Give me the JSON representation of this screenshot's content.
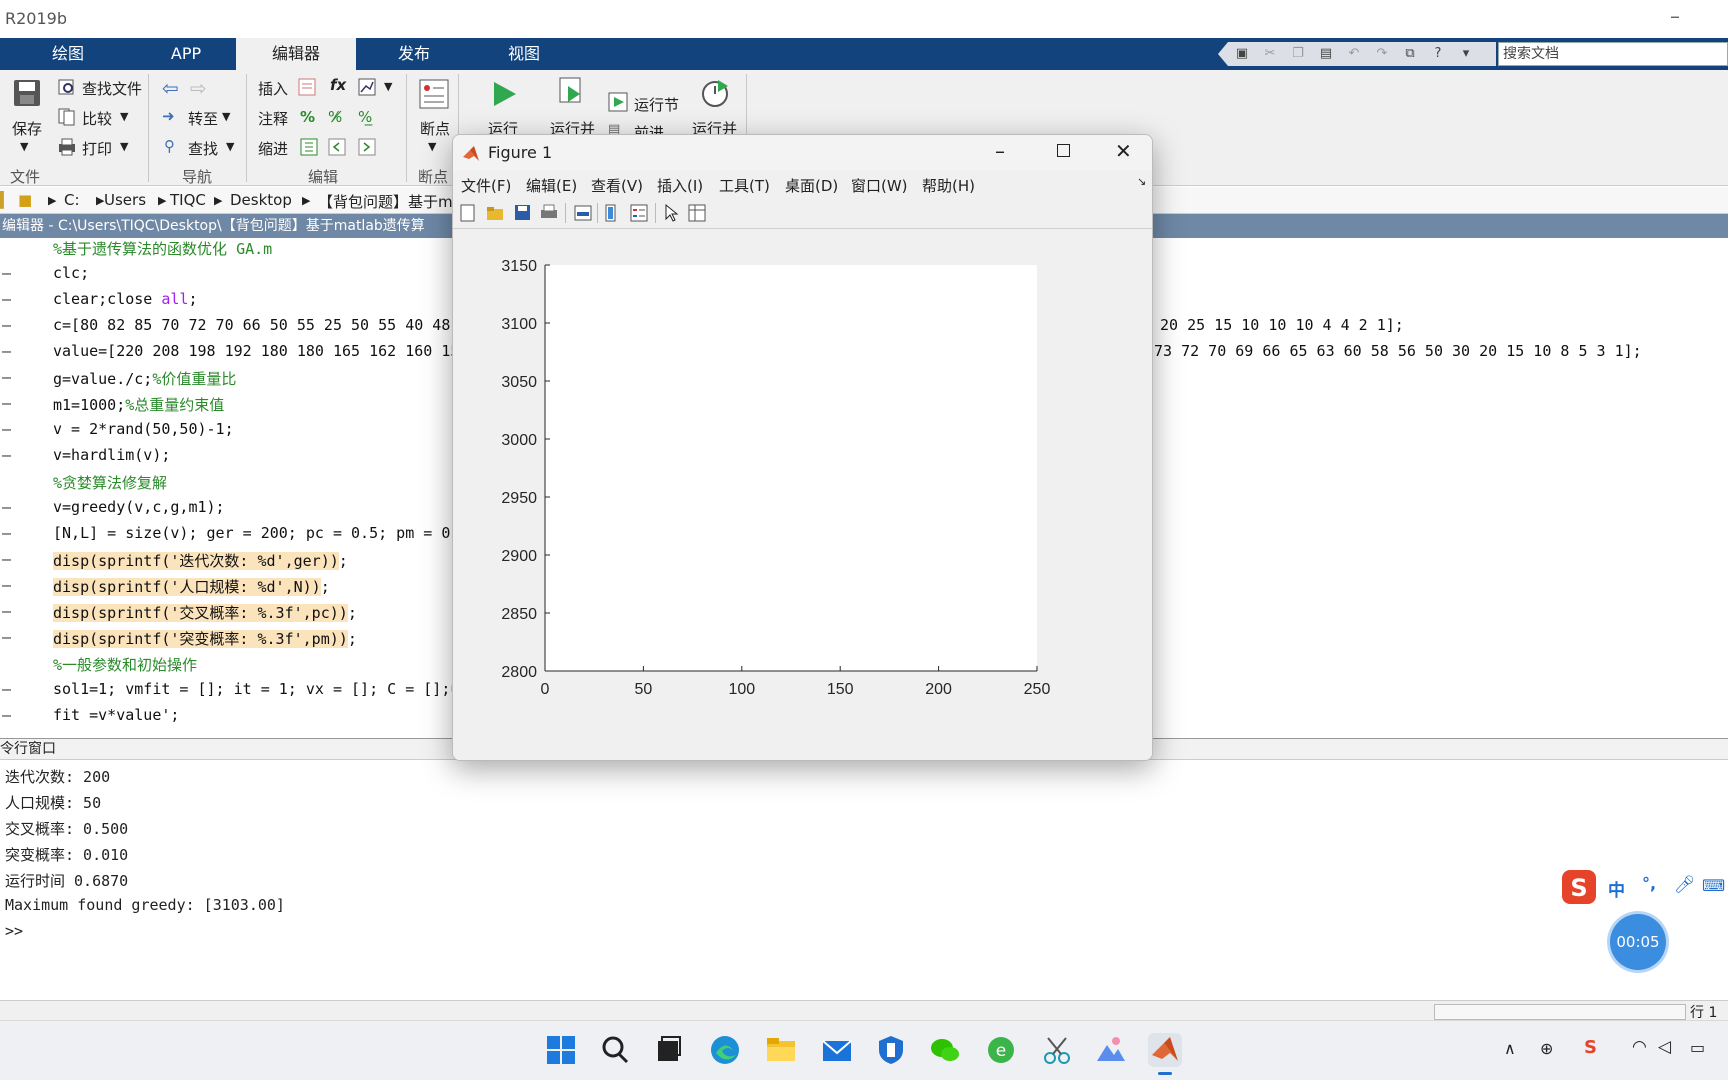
{
  "app": {
    "title": "R2019b",
    "minimize_glyph": "–"
  },
  "ribbon_tabs": [
    "绘图",
    "APP",
    "编辑器",
    "发布",
    "视图"
  ],
  "search": {
    "placeholder": "搜索文档"
  },
  "ribbon": {
    "file": {
      "save": "保存",
      "find_files": "查找文件",
      "compare": "比较",
      "print": "打印",
      "section": "文件"
    },
    "nav": {
      "goto": "转至",
      "find": "查找",
      "section": "导航"
    },
    "edit": {
      "insert": "插入",
      "comment": "注释",
      "indent": "缩进",
      "fx": "fx",
      "section": "编辑"
    },
    "breakpoints": {
      "label": "断点",
      "section": "断点"
    },
    "run": {
      "run": "运行",
      "run_advance": "运行并",
      "run_section": "运行节",
      "advance": "前进",
      "run_time": "运行并"
    }
  },
  "address": [
    "C:",
    "Users",
    "TIQC",
    "Desktop",
    "【背包问题】基于m"
  ],
  "editor": {
    "header": "编辑器 - C:\\Users\\TIQC\\Desktop\\【背包问题】基于matlab遗传算",
    "lines": [
      {
        "dash": false,
        "type": "comment",
        "text": "%基于遗传算法的函数优化 GA.m"
      },
      {
        "dash": true,
        "type": "code",
        "text": "clc;"
      },
      {
        "dash": true,
        "type": "kw",
        "text": "clear;close ",
        "kw": "all",
        "tail": ";"
      },
      {
        "dash": true,
        "type": "code",
        "text": "c=[80 82 85 70 72 70 66 50 55 25 50 55 40 48",
        "right": "20 25 15 10 10 10 4 4 2 1];"
      },
      {
        "dash": true,
        "type": "code",
        "text": "value=[220 208 198 192 180 180 165 162 160 15",
        "right": "73 72 70 69 66 65 63 60 58 56 50 30 20 15 10 8 5 3 1];"
      },
      {
        "dash": true,
        "type": "mixed",
        "text": "g=value./c;",
        "comment": "%价值重量比"
      },
      {
        "dash": true,
        "type": "mixed",
        "text": "m1=1000;",
        "comment": "%总重量约束值"
      },
      {
        "dash": true,
        "type": "code",
        "text": "v = 2*rand(50,50)-1;"
      },
      {
        "dash": true,
        "type": "code",
        "text": "v=hardlim(v);"
      },
      {
        "dash": false,
        "type": "comment",
        "text": "%贪婪算法修复解"
      },
      {
        "dash": true,
        "type": "code",
        "text": "v=greedy(v,c,g,m1);"
      },
      {
        "dash": true,
        "type": "code",
        "text": "[N,L] = size(v); ger = 200; pc = 0.5; pm = 0."
      },
      {
        "dash": true,
        "type": "hl",
        "text": "disp(sprintf('迭代次数: %d',ger))",
        "tail": ";"
      },
      {
        "dash": true,
        "type": "hl",
        "text": "disp(sprintf('人口规模: %d',N))",
        "tail": ";"
      },
      {
        "dash": true,
        "type": "hl",
        "text": "disp(sprintf('交叉概率: %.3f',pc))",
        "tail": ";"
      },
      {
        "dash": true,
        "type": "hl",
        "text": "disp(sprintf('突变概率: %.3f',pm))",
        "tail": ";"
      },
      {
        "dash": false,
        "type": "comment",
        "text": "%一般参数和初始操作"
      },
      {
        "dash": true,
        "type": "code",
        "text": "sol1=1; vmfit = []; it = 1; vx = []; C = [];u"
      },
      {
        "dash": true,
        "type": "code",
        "text": "fit =v*value';"
      }
    ]
  },
  "command": {
    "header": "令行窗口",
    "lines": [
      "迭代次数: 200",
      "人口规模: 50",
      "交叉概率: 0.500",
      "突变概率: 0.010",
      "运行时间 0.6870",
      "Maximum found greedy: [3103.00]",
      ">>"
    ]
  },
  "status": {
    "row_label": "行 1"
  },
  "figure": {
    "title": "Figure 1",
    "menu": [
      "文件(F)",
      "编辑(E)",
      "查看(V)",
      "插入(I)",
      "工具(T)",
      "桌面(D)",
      "窗口(W)",
      "帮助(H)"
    ]
  },
  "chart_data": {
    "type": "line",
    "title": "",
    "xlabel": "",
    "ylabel": "",
    "xlim": [
      0,
      250
    ],
    "ylim": [
      2800,
      3150
    ],
    "xticks": [
      0,
      50,
      100,
      150,
      200,
      250
    ],
    "yticks": [
      2800,
      2850,
      2900,
      2950,
      3000,
      3050,
      3100,
      3150
    ],
    "series": []
  },
  "ime": {
    "chinese": "中",
    "punct": "°,",
    "logo": "S"
  },
  "timer": "00:05",
  "colors": {
    "ribbon_tab_bg": "#12437c",
    "editor_header": "#6e88a6",
    "comment": "#2a8a2a",
    "keyword": "#a020f0",
    "highlight": "#fbe3bc"
  }
}
